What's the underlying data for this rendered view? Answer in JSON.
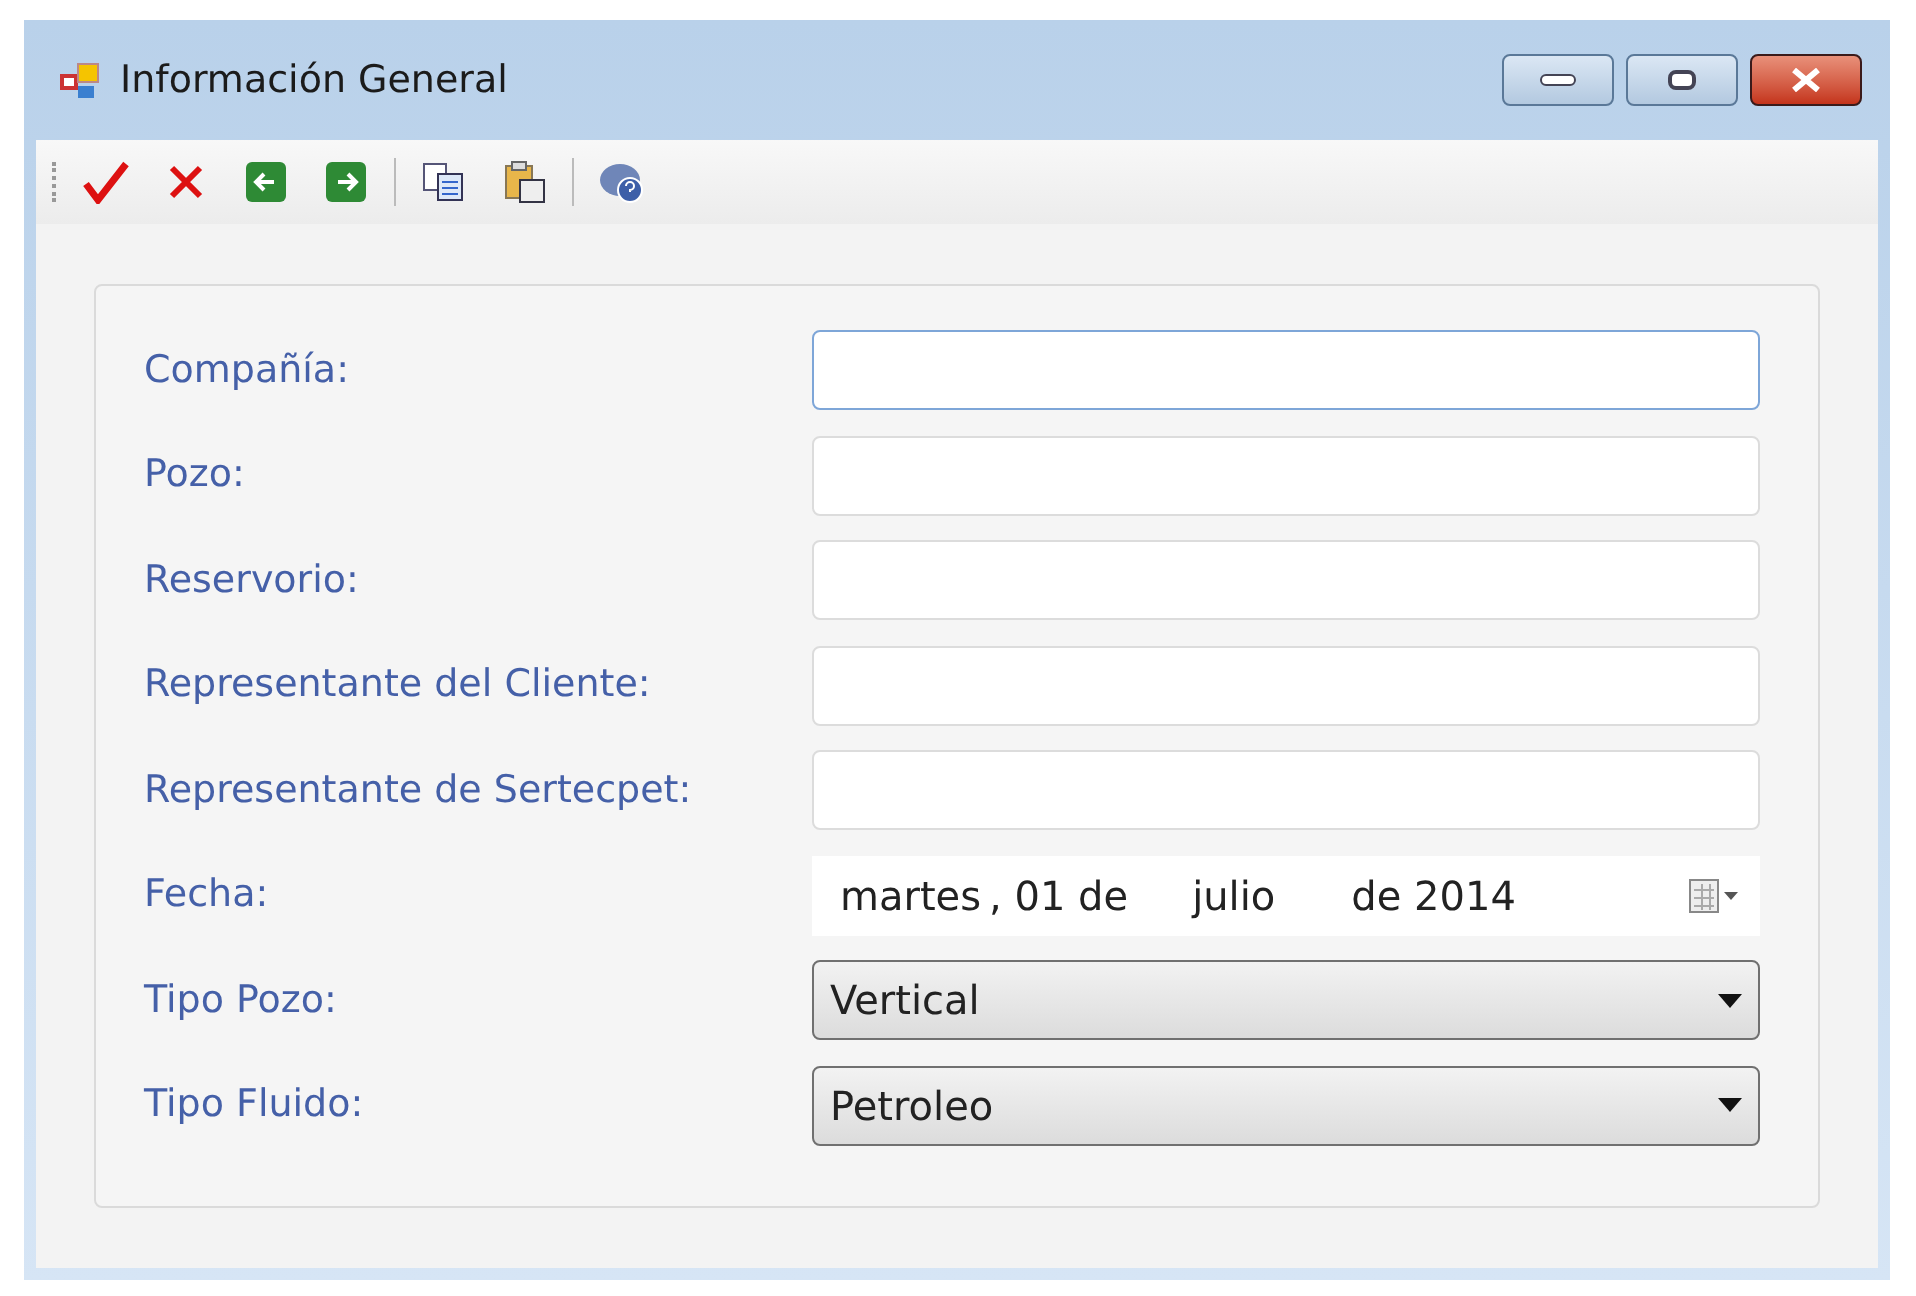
{
  "window": {
    "title": "Información General"
  },
  "fields": [
    {
      "label": "Compañía:",
      "kind": "text",
      "focused": true
    },
    {
      "label": "Pozo:",
      "kind": "text",
      "focused": false
    },
    {
      "label": "Reservorio:",
      "kind": "text",
      "focused": false
    },
    {
      "label": "Representante del Cliente:",
      "kind": "text",
      "focused": false
    },
    {
      "label": "Representante de Sertecpet:",
      "kind": "text",
      "focused": false
    },
    {
      "label": "Fecha:",
      "kind": "date",
      "parts": [
        "martes",
        ", 01 de",
        "julio",
        "de 2014"
      ]
    },
    {
      "label": "Tipo Pozo:",
      "kind": "combo",
      "value": "Vertical"
    },
    {
      "label": "Tipo Fluido:",
      "kind": "combo",
      "value": "Petroleo"
    }
  ]
}
